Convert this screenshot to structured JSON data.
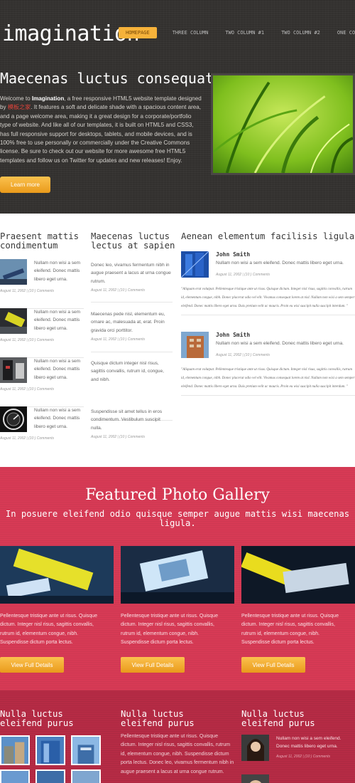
{
  "header": {
    "logo": "imagination",
    "nav": [
      "HOMEPAGE",
      "THREE COLUMN",
      "TWO COLUMN #1",
      "TWO COLUMN #2",
      "ONE COLUMN"
    ],
    "hero_title": "Maecenas luctus consequat",
    "hero_text_1": "Welcome to ",
    "hero_text_brand": "Imagination",
    "hero_text_2": ", a free responsive HTML5 website template designed by ",
    "hero_text_red": "模板之家",
    "hero_text_3": ". It features a soft and delicate shade with a spacious content area, and a page welcome area, making it a great design for a corporate/portfolio type of website. And like all of our templates, it is built on HTML5 and CSS3, has full responsive support for desktops, tablets, and mobile devices, and is 100% free to use personally or commercially under the Creative Commons license. Be sure to check out our website for more awesome free HTML5 templates and follow us on Twitter for updates and new releases! Enjoy.",
    "learn_more": "Learn more"
  },
  "columns": {
    "col1_title": "Praesent mattis condimentum",
    "col2_title": "Maecenas luctus lectus at sapien",
    "col3_title": "Aenean elementum facilisis ligula",
    "col1_items": [
      {
        "text": "Nullam non wisi a sem eleifend. Donec mattis libero eget urna.",
        "meta": "August 11, 2002 | (10 ) Comments"
      },
      {
        "text": "Nullam non wisi a sem eleifend. Donec mattis libero eget urna.",
        "meta": "August 11, 2002 | (10 ) Comments"
      },
      {
        "text": "Nullam non wisi a sem eleifend. Donec mattis libero eget urna.",
        "meta": "August 11, 2002 | (10 ) Comments"
      },
      {
        "text": "Nullam non wisi a sem eleifend. Donec mattis libero eget urna.",
        "meta": "August 11, 2002 | (10 ) Comments"
      }
    ],
    "col2_items": [
      {
        "text": "Donec leo, vivamus fermentum nibh in augue praesent a lacus at urna congue rutrum.",
        "meta": "August 11, 2002 | (10 ) Comments"
      },
      {
        "text": "Maecenas pede nisl, elementum eu, ornare ac, malesuada at, erat. Proin gravida orci porttitor.",
        "meta": "August 11, 2002 | (10 ) Comments"
      },
      {
        "text": "Quisque dictum integer nisl risus, sagittis convallis, rutrum id, congue, and nibh.",
        "meta": "August 11, 2002 | (10 ) Comments"
      },
      {
        "text": "Suspendisse sit amet tellus in eros condimentum. Vestibulum suscipit nulla.",
        "meta": "August 11, 2002 | (10 ) Comments"
      }
    ],
    "col3_items": [
      {
        "name": "John Smith",
        "text": "Nullam non wisi a sem eleifend. Donec mattis libero eget urna.",
        "meta": "August 11, 2002 | (10 ) Comments",
        "quote": "\"Aliquam erat volutpat. Pellentesque tristique ante ut risus. Quisque dictum. Integer nisl risus, sagittis convallis, rutrum id, elementum congue, nibh. Donec placerat odio vel elit. Vivamus consequat lorem at nisl. Nullam non wisi a sem semper eleifend. Donec mattis libero eget urna. Duis pretium velit ac mauris. Proin eu wisi suscipit nulla suscipit interdum. \""
      },
      {
        "name": "John Smith",
        "text": "Nullam non wisi a sem eleifend. Donec mattis libero eget urna.",
        "meta": "August 11, 2002 | (10 ) Comments",
        "quote": "\"Aliquam erat volutpat. Pellentesque tristique ante ut risus. Quisque dictum. Integer nisl risus, sagittis convallis, rutrum id, elementum congue, nibh. Donec placerat odio vel elit. Vivamus consequat lorem at nisl. Nullam non wisi a sem semper eleifend. Donec mattis libero eget urna. Duis pretium velit ac mauris. Proin eu wisi suscipit nulla suscipit interdum. \""
      }
    ]
  },
  "gallery": {
    "title": "Featured Photo Gallery",
    "subtitle": "In posuere eleifend odio quisque semper augue mattis wisi maecenas ligula.",
    "cards": [
      {
        "text": "Pellentesque tristique ante ut risus. Quisque dictum. Integer nisl risus, sagittis convallis, rutrum id, elementum congue, nibh. Suspendisse dictum porta lectus.",
        "button": "View Full Details"
      },
      {
        "text": "Pellentesque tristique ante ut risus. Quisque dictum. Integer nisl risus, sagittis convallis, rutrum id, elementum congue, nibh. Suspendisse dictum porta lectus.",
        "button": "View Full Details"
      },
      {
        "text": "Pellentesque tristique ante ut risus. Quisque dictum. Integer nisl risus, sagittis convallis, rutrum id, elementum congue, nibh. Suspendisse dictum porta lectus.",
        "button": "View Full Details"
      }
    ]
  },
  "bottom": {
    "titles": [
      "Nulla luctus eleifend purus",
      "Nulla luctus eleifend purus",
      "Nulla luctus eleifend purus"
    ],
    "text": "Pellentesque tristique ante ut risus. Quisque dictum. Integer nisl risus, sagittis convallis, rutrum id, elementum congue, nibh. Suspendisse dictum porta lectus. Donec leo, vivamus fermentum nibh in augue praesent a lacus at urna congue rutrum.",
    "person_text": "Nullam non wisi a sem eleifend. Donec mattis libero eget urna.",
    "person_meta": "August 11, 2002 | (10 ) Comments"
  },
  "colors": {
    "header_bg": "#343230",
    "accent_orange": "#f6b23a",
    "gallery_red": "#d73a55",
    "bottom_red": "#b62b45"
  }
}
